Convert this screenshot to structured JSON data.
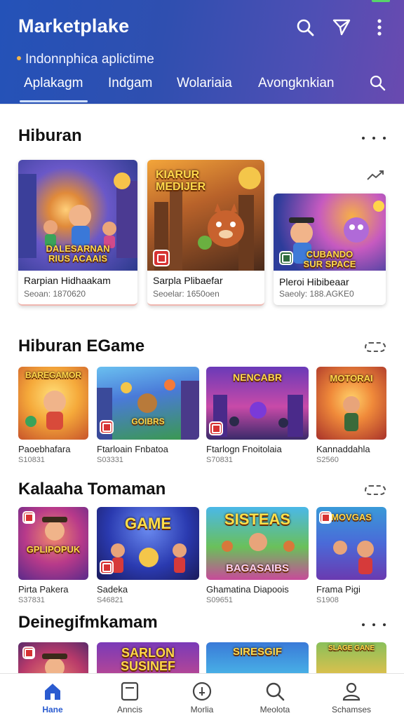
{
  "header": {
    "title": "Marketplake",
    "subtitle": "Indonnphica aplictime",
    "tabs": [
      {
        "label": "Aplakagm"
      },
      {
        "label": "Indgam"
      },
      {
        "label": "Wolariaia"
      },
      {
        "label": "Avongknkian"
      }
    ],
    "accent": "#2a5bd0"
  },
  "sections": [
    {
      "title": "Hiburan",
      "featured": [
        {
          "name": "Rarpian Hidhaakam",
          "meta": "Seoan: 1870620",
          "art_text": "DALESARNAN\nRIUS ACAAIS"
        },
        {
          "name": "Sarpla Plibaefar",
          "meta": "Seoelar: 1650oen",
          "art_text": "KIARUR\nMEDIJER"
        },
        {
          "name": "Pleroi Hibibeaar",
          "meta": "Saeoly: 188.AGKE0",
          "art_text": "CUBANDO\nSUR SPACE"
        }
      ]
    },
    {
      "title": "Hiburan EGame",
      "tiles": [
        {
          "name": "Paoebhafara",
          "meta": "S10831",
          "art_text": "BAREGAMOR"
        },
        {
          "name": "Ftarloain Fnbatoa",
          "meta": "S03331",
          "art_text": "GOIBRS"
        },
        {
          "name": "Ftarlogn Fnoitolaia",
          "meta": "S70831",
          "art_text": "NENCABR"
        },
        {
          "name": "Kannaddahla",
          "meta": "S2560",
          "art_text": "MOTORAI"
        }
      ]
    },
    {
      "title": "Kalaaha Tomaman",
      "tiles": [
        {
          "name": "Pirta Pakera",
          "meta": "S37831",
          "art_text": "GPLIPOPUK"
        },
        {
          "name": "Sadeka",
          "meta": "S46821",
          "art_text": "GAME"
        },
        {
          "name": "Ghamatina Diapoois",
          "meta": "S09651",
          "art_text": "SISTEAS\nBAGASAIBS"
        },
        {
          "name": "Frama Pigi",
          "meta": "S1908",
          "art_text": "MOVGAS"
        }
      ]
    },
    {
      "title": "Deinegifmkamam",
      "tiles": [
        {
          "name": "",
          "meta": "",
          "art_text": ""
        },
        {
          "name": "",
          "meta": "",
          "art_text": "SARLON\nSUSINEF"
        },
        {
          "name": "",
          "meta": "",
          "art_text": "SIRESGIF"
        },
        {
          "name": "",
          "meta": "",
          "art_text": "SLAGE GANE"
        }
      ]
    }
  ],
  "bottom_nav": [
    {
      "label": "Hane",
      "icon": "home-icon",
      "active": true
    },
    {
      "label": "Anncis",
      "icon": "tablet-icon"
    },
    {
      "label": "Morlia",
      "icon": "compass-icon"
    },
    {
      "label": "Meolota",
      "icon": "search-icon"
    },
    {
      "label": "Schamses",
      "icon": "profile-icon"
    }
  ]
}
